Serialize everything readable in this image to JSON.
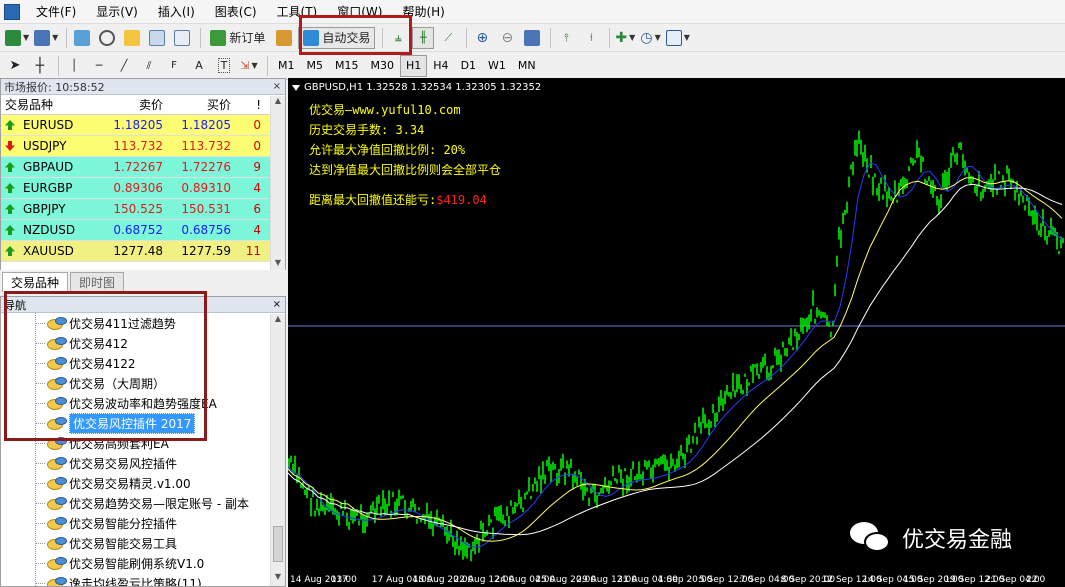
{
  "menu": {
    "items": [
      "文件(F)",
      "显示(V)",
      "插入(I)",
      "图表(C)",
      "工具(T)",
      "窗口(W)",
      "帮助(H)"
    ]
  },
  "toolbar": {
    "new_order_label": "新订单",
    "auto_trade_label": "自动交易",
    "timeframes": [
      "M1",
      "M5",
      "M15",
      "M30",
      "H1",
      "H4",
      "D1",
      "W1",
      "MN"
    ],
    "active_timeframe": "H1",
    "draw_tools": [
      "A",
      "T"
    ]
  },
  "market_watch": {
    "title": "市场报价: 10:58:52",
    "close_symbol": "×",
    "columns": [
      "交易品种",
      "卖价",
      "买价",
      "!"
    ],
    "rows": [
      {
        "symbol": "EURUSD",
        "bid": "1.18205",
        "ask": "1.18205",
        "spread": "0",
        "dir": "up",
        "bg": "yellow",
        "price_color": "blue"
      },
      {
        "symbol": "USDJPY",
        "bid": "113.732",
        "ask": "113.732",
        "spread": "0",
        "dir": "down",
        "bg": "yellow",
        "price_color": "red"
      },
      {
        "symbol": "GBPAUD",
        "bid": "1.72267",
        "ask": "1.72276",
        "spread": "9",
        "dir": "up",
        "bg": "teal",
        "price_color": "red"
      },
      {
        "symbol": "EURGBP",
        "bid": "0.89306",
        "ask": "0.89310",
        "spread": "4",
        "dir": "up",
        "bg": "teal",
        "price_color": "red"
      },
      {
        "symbol": "GBPJPY",
        "bid": "150.525",
        "ask": "150.531",
        "spread": "6",
        "dir": "up",
        "bg": "teal",
        "price_color": "red"
      },
      {
        "symbol": "NZDUSD",
        "bid": "0.68752",
        "ask": "0.68756",
        "spread": "4",
        "dir": "up",
        "bg": "teal",
        "price_color": "blue"
      },
      {
        "symbol": "XAUUSD",
        "bid": "1277.48",
        "ask": "1277.59",
        "spread": "11",
        "dir": "up",
        "bg": "khaki",
        "price_color": "dark"
      }
    ]
  },
  "tabs": [
    "交易品种",
    "即时图"
  ],
  "navigator": {
    "title": "导航",
    "close_symbol": "×",
    "items": [
      "优交易411过滤趋势",
      "优交易412",
      "优交易4122",
      "优交易（大周期）",
      "优交易波动率和趋势强度EA",
      "优交易风控插件 2017",
      "优交易高频套利EA",
      "优交易交易风控插件",
      "优交易交易精灵.v1.00",
      "优交易趋势交易—限定账号 - 副本",
      "优交易智能分控插件",
      "优交易智能交易工具",
      "优交易智能刷佣系统V1.0",
      "逸走均线盈亏比策略(11)"
    ],
    "selected_index": 5
  },
  "chart": {
    "header": "GBPUSD,H1  1.32528 1.32534 1.32305 1.32352",
    "ea_lines": [
      "优交易—www.yuful10.com",
      "历史交易手数: 3.34",
      "允许最大净值回撤比例: 20%",
      "达到净值最大回撤比例则会全部平仓"
    ],
    "drawdown_label": "距离最大回撤值还能亏:",
    "drawdown_value": "$419.04",
    "watermark": "优交易金融",
    "x_ticks": [
      "14 Aug 2017",
      "13:00",
      "17 Aug 04:00",
      "18 Aug 20:00",
      "22 Aug 12:00",
      "24 Aug 04:00",
      "25 Aug 20:00",
      "29 Aug 12:00",
      "31 Aug 04:00",
      "1 Sep 20:00",
      "5 Sep 12:00",
      "7 Sep 04:00",
      "8 Sep 20:00",
      "12 Sep 12:00",
      "14 Sep 04:00",
      "15 Sep 20:00",
      "19 Sep 12:00",
      "21 Sep 04:00",
      "22"
    ]
  },
  "colors": {
    "candle": "#00ff00",
    "ma_fast": "#ffff66",
    "ma_slow": "#ffffff",
    "ma_blue": "#2a3bff",
    "text_yellow": "#ffff00",
    "text_red": "#ff2020",
    "hline": "#6e7fd8"
  }
}
